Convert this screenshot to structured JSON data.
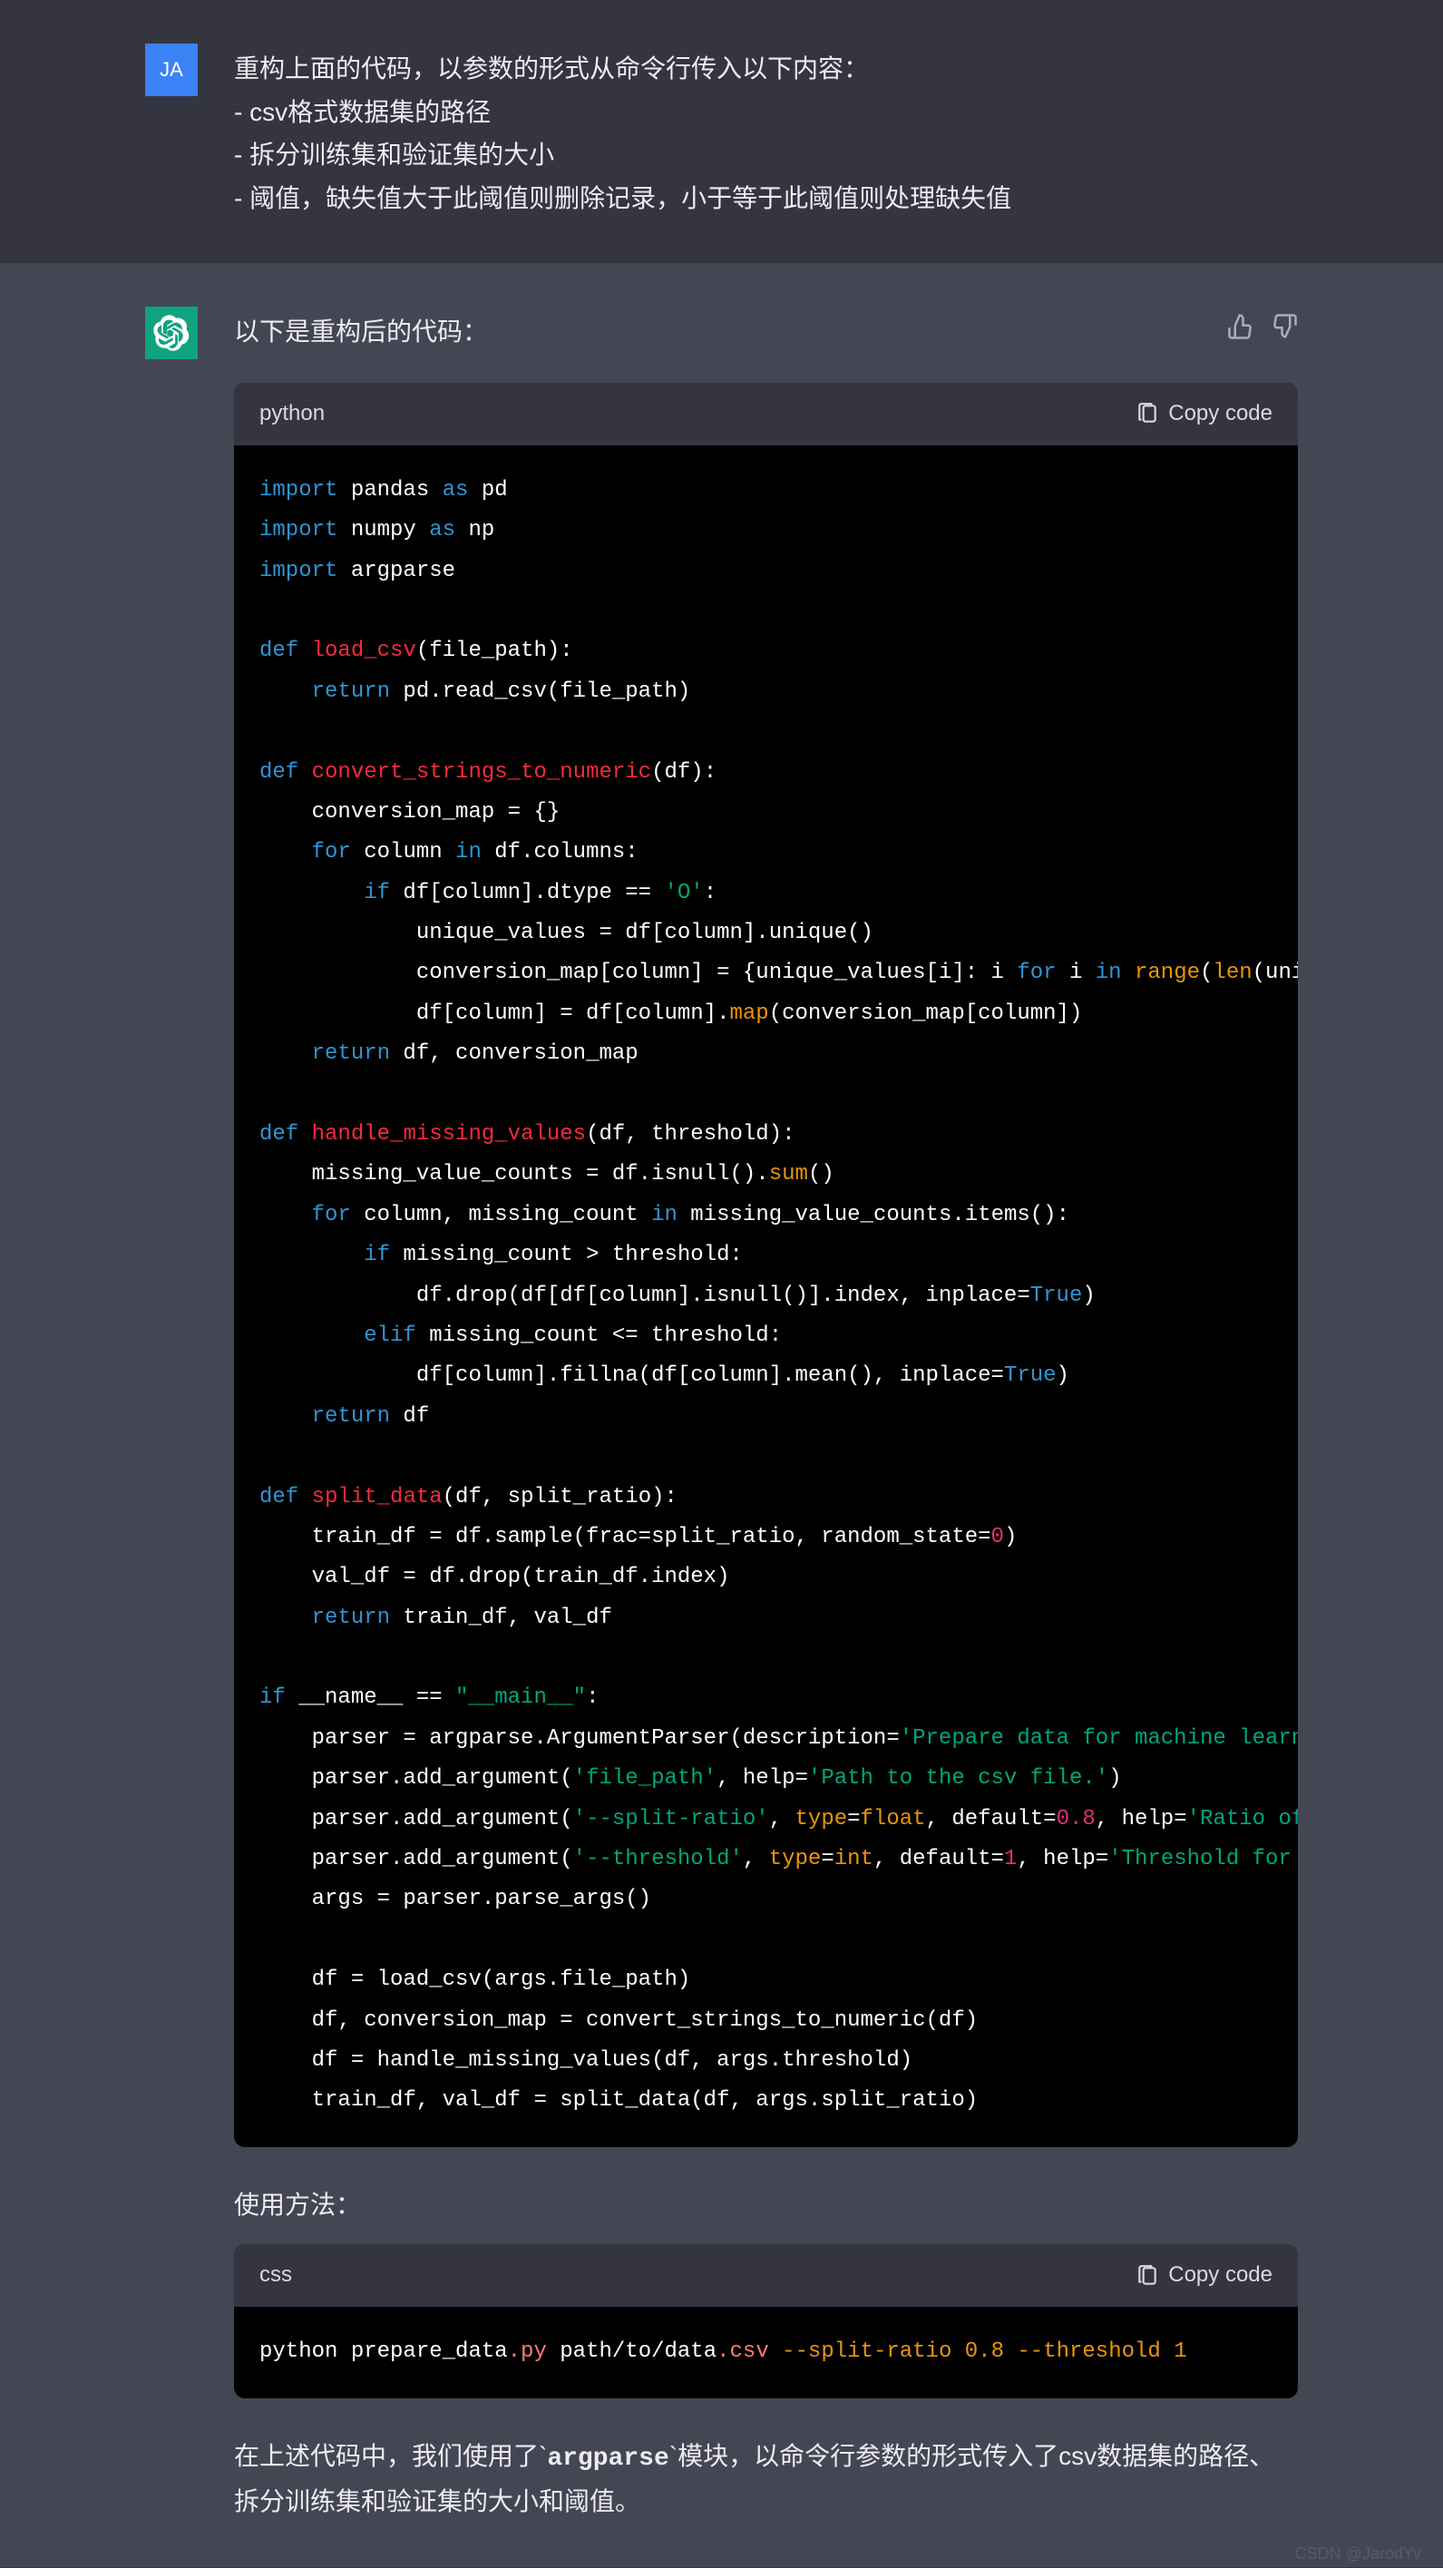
{
  "user": {
    "avatar_text": "JA",
    "message": "重构上面的代码，以参数的形式从命令行传入以下内容：\n- csv格式数据集的路径\n- 拆分训练集和验证集的大小\n- 阈值，缺失值大于此阈值则删除记录，小于等于此阈值则处理缺失值"
  },
  "bot": {
    "intro": "以下是重构后的代码：",
    "code1_lang": "python",
    "copy_label": "Copy code",
    "usage_label": "使用方法：",
    "code2_lang": "css",
    "closing_prefix": "在上述代码中，我们使用了`",
    "closing_mid": "argparse",
    "closing_suffix": "`模块，以命令行参数的形式传入了csv数据集的路径、拆分训练集和验证集的大小和阈值。"
  },
  "watermark": "CSDN @JarodYv"
}
